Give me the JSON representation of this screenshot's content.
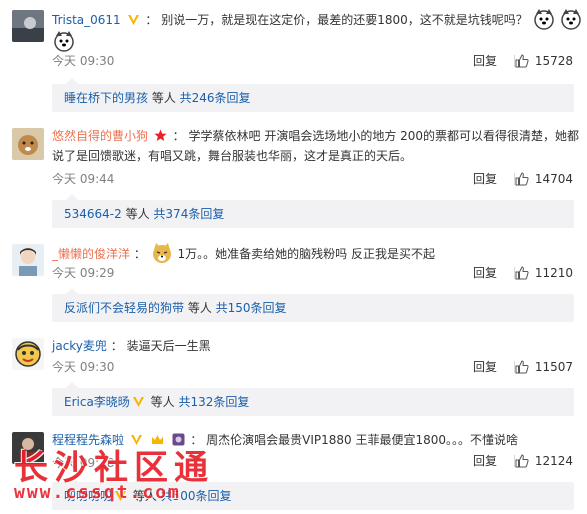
{
  "comments": [
    {
      "username": "Trista_0611",
      "colon": "：",
      "text": "别说一万，就是现在这定价，最差的还要1800，这不就是坑钱呢吗？",
      "time": "今天 09:30",
      "reply": "回复",
      "likes": "15728",
      "sub_user": "睡在桥下的男孩",
      "sub_mid": " 等人 ",
      "sub_count": "共246条回复"
    },
    {
      "username": "悠然自得的曹小狗",
      "colon": "：",
      "text": "学学蔡依林吧 开演唱会选场地小的地方 200的票都可以看得很清楚，她都",
      "text2": "说了是回馈歌迷，有唱又跳，舞台服装也华丽，这才是真正的天后。",
      "time": "今天 09:44",
      "reply": "回复",
      "likes": "14704",
      "sub_user": "534664-2",
      "sub_mid": " 等人 ",
      "sub_count": "共374条回复"
    },
    {
      "username": "_懒懒的俊洋洋",
      "colon": "：",
      "text": "1万。。她准备卖给她的脑残粉吗 反正我是买不起",
      "time": "今天 09:29",
      "reply": "回复",
      "likes": "11210",
      "sub_user": "反派们不会轻易的狗带",
      "sub_mid": " 等人 ",
      "sub_count": "共150条回复"
    },
    {
      "username": "jacky麦兜",
      "colon": "：",
      "text": "装逼天后一生黑",
      "time": "今天 09:30",
      "reply": "回复",
      "likes": "11507",
      "sub_user": "Erica李晓旸",
      "sub_mid": " 等人 ",
      "sub_count": "共132条回复"
    },
    {
      "username": "程程程先森啦",
      "colon": "：",
      "text": "周杰伦演唱会最贵VIP1880 王菲最便宜1800。。。不懂说啥",
      "time": "今天 09:38",
      "reply": "回复",
      "likes": "12124",
      "sub_user": "叨叨叨叨",
      "sub_mid": " 等人 ",
      "sub_count": "共500条回复"
    }
  ],
  "watermark": {
    "main": "长沙社区通",
    "url": "www.cssqt.com"
  },
  "colors": {
    "username": "#eb7350",
    "link": "#1a5fa8",
    "meta": "#808080",
    "subbox": "#f2f2f5",
    "watermark": "#e8202a"
  }
}
